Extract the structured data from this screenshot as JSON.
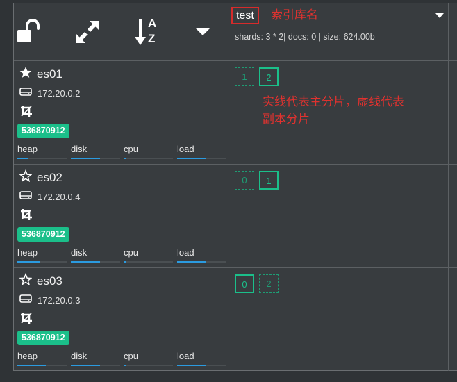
{
  "toolbar": {
    "icons": [
      "unlock-icon",
      "expand-icon",
      "sort-az-icon",
      "caret-down-icon"
    ],
    "sort_letters": [
      "A",
      "Z"
    ]
  },
  "index": {
    "name": "test",
    "stats": "shards: 3 * 2| docs: 0 | size: 624.00b"
  },
  "annotations": {
    "index_label": "索引库名",
    "shard_note_line1": "实线代表主分片，虚线代表",
    "shard_note_line2": "副本分片"
  },
  "metric_labels": [
    "heap",
    "disk",
    "cpu",
    "load"
  ],
  "nodes": [
    {
      "name": "es01",
      "master": true,
      "ip": "172.20.0.2",
      "badge": "536870912",
      "metrics": {
        "heap": 0.22,
        "disk": 0.59,
        "cpu": 0.05,
        "load": 0.58
      },
      "shards": [
        {
          "label": "1",
          "type": "replica"
        },
        {
          "label": "2",
          "type": "primary"
        }
      ]
    },
    {
      "name": "es02",
      "master": false,
      "ip": "172.20.0.4",
      "badge": "536870912",
      "metrics": {
        "heap": 0.47,
        "disk": 0.59,
        "cpu": 0.05,
        "load": 0.58
      },
      "shards": [
        {
          "label": "0",
          "type": "replica"
        },
        {
          "label": "1",
          "type": "primary"
        }
      ]
    },
    {
      "name": "es03",
      "master": false,
      "ip": "172.20.0.3",
      "badge": "536870912",
      "metrics": {
        "heap": 0.58,
        "disk": 0.59,
        "cpu": 0.05,
        "load": 0.58
      },
      "shards": [
        {
          "label": "0",
          "type": "primary"
        },
        {
          "label": "2",
          "type": "replica"
        }
      ]
    }
  ],
  "colors": {
    "accent": "#1bbf8a",
    "bar": "#2b9be0",
    "annotation": "#e0322f"
  }
}
